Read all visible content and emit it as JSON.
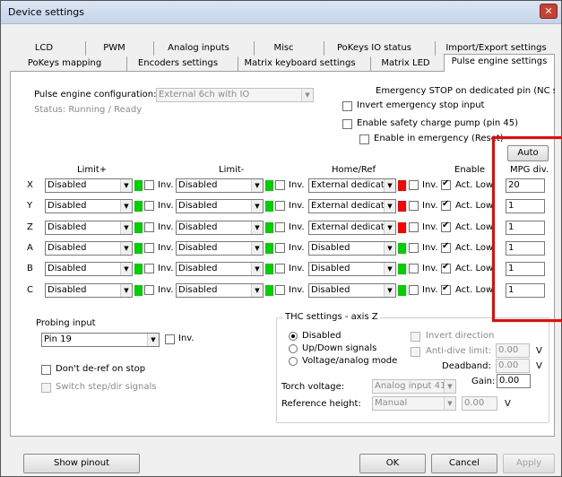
{
  "window": {
    "title": "Device settings",
    "close_symbol": "✕"
  },
  "tabs_row1": [
    "LCD",
    "PWM",
    "Analog inputs",
    "Misc",
    "PoKeys IO status",
    "Import/Export settings"
  ],
  "tabs_row2": [
    "PoKeys mapping",
    "Encoders settings",
    "Matrix keyboard settings",
    "Matrix LED",
    "Pulse engine settings"
  ],
  "active_tab": "Pulse engine settings",
  "config": {
    "label": "Pulse engine configuration:",
    "value": "External 6ch with IO",
    "status": "Status: Running / Ready"
  },
  "emergency": {
    "title": "Emergency STOP on dedicated pin (NC switcl",
    "invert_label": "Invert emergency stop input",
    "charge_pump_label": "Enable safety charge pump (pin 45)",
    "enable_in_emergency_label": "Enable in emergency (Reset)"
  },
  "auto_button": "Auto",
  "headers": {
    "limit_plus": "Limit+",
    "limit_minus": "Limit-",
    "home_ref": "Home/Ref",
    "enable": "Enable",
    "mpg_div": "MPG div."
  },
  "inv_label": "Inv.",
  "act_low_label": "Act. Low",
  "axes": [
    {
      "axis": "X",
      "limit_plus": "Disabled",
      "limit_minus": "Disabled",
      "home": "External dedicate",
      "home_led": "#ff0000",
      "mpg": "20"
    },
    {
      "axis": "Y",
      "limit_plus": "Disabled",
      "limit_minus": "Disabled",
      "home": "External dedicate",
      "home_led": "#ff0000",
      "mpg": "1"
    },
    {
      "axis": "Z",
      "limit_plus": "Disabled",
      "limit_minus": "Disabled",
      "home": "External dedicate",
      "home_led": "#ff0000",
      "mpg": "1"
    },
    {
      "axis": "A",
      "limit_plus": "Disabled",
      "limit_minus": "Disabled",
      "home": "Disabled",
      "home_led": "#00d000",
      "mpg": "1"
    },
    {
      "axis": "B",
      "limit_plus": "Disabled",
      "limit_minus": "Disabled",
      "home": "Disabled",
      "home_led": "#00d000",
      "mpg": "1"
    },
    {
      "axis": "C",
      "limit_plus": "Disabled",
      "limit_minus": "Disabled",
      "home": "Disabled",
      "home_led": "#00d000",
      "mpg": "1"
    }
  ],
  "limit_led_color": "#00d000",
  "probing": {
    "label": "Probing input",
    "value": "Pin 19",
    "inv_label": "Inv."
  },
  "dont_deref_label": "Don't de-ref on stop",
  "switch_step_dir_label": "Switch step/dir signals",
  "thc": {
    "title": "THC settings - axis Z",
    "options": [
      "Disabled",
      "Up/Down signals",
      "Voltage/analog mode"
    ],
    "selected": "Disabled",
    "invert_direction_label": "Invert direction",
    "anti_dive_label": "Anti-dive limit:",
    "anti_dive_value": "0.00",
    "anti_dive_unit": "V",
    "deadband_label": "Deadband:",
    "deadband_value": "0.00",
    "deadband_unit": "V",
    "gain_label": "Gain:",
    "gain_value": "0.00",
    "torch_voltage_label": "Torch voltage:",
    "torch_voltage_value": "Analog input 41",
    "reference_height_label": "Reference height:",
    "reference_height_value": "Manual",
    "reference_height_number": "0.00",
    "reference_height_unit": "V"
  },
  "footer": {
    "show_pinout": "Show pinout",
    "ok": "OK",
    "cancel": "Cancel",
    "apply": "Apply"
  },
  "highlight_color": "#ff0000"
}
